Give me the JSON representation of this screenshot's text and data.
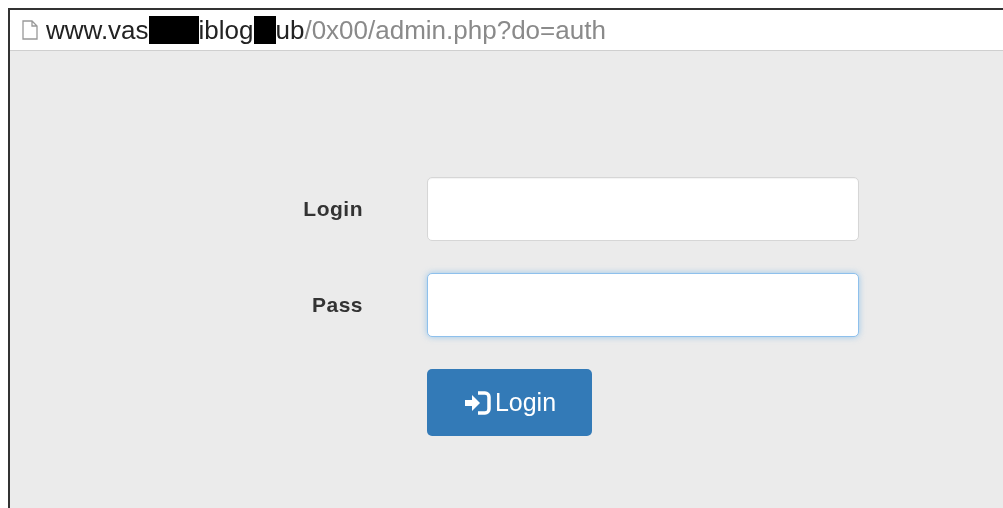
{
  "address_bar": {
    "parts": [
      {
        "kind": "host",
        "text": "www.vas"
      },
      {
        "kind": "redacted"
      },
      {
        "kind": "host",
        "text": "iblog"
      },
      {
        "kind": "redacted"
      },
      {
        "kind": "host",
        "text": "ub"
      },
      {
        "kind": "path",
        "text": "/0x00/admin.php?do=auth"
      }
    ]
  },
  "form": {
    "fields": [
      {
        "label": "Login",
        "focused": false
      },
      {
        "label": "Pass",
        "focused": true
      }
    ],
    "button": {
      "label": "Login"
    }
  }
}
